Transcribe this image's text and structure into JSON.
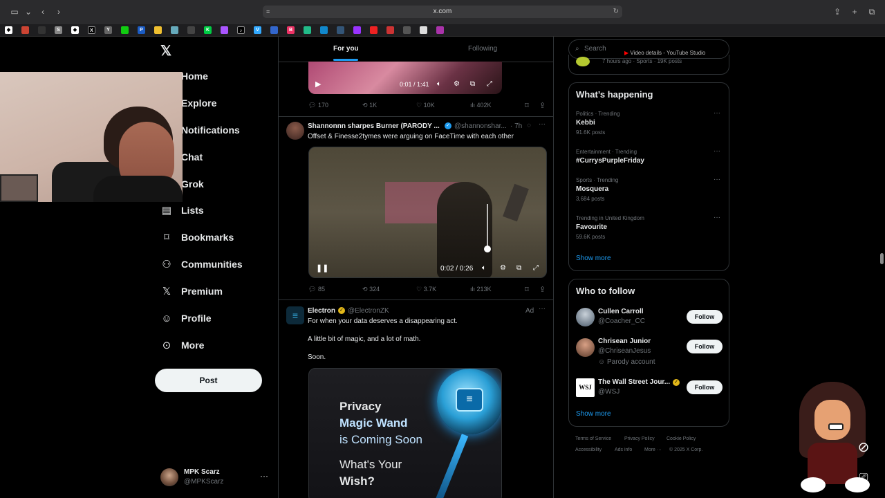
{
  "browser": {
    "url": "x.com",
    "youtube_tab": "Video details - YouTube Studio"
  },
  "nav": {
    "items": [
      {
        "label": "Home",
        "icon": "home-icon"
      },
      {
        "label": "Explore",
        "icon": "search-icon"
      },
      {
        "label": "Notifications",
        "icon": "bell-icon"
      },
      {
        "label": "Chat",
        "icon": "mail-icon"
      },
      {
        "label": "Grok",
        "icon": "grok-icon"
      },
      {
        "label": "Lists",
        "icon": "lists-icon"
      },
      {
        "label": "Bookmarks",
        "icon": "bookmark-icon"
      },
      {
        "label": "Communities",
        "icon": "communities-icon"
      },
      {
        "label": "Premium",
        "icon": "x-logo-icon"
      },
      {
        "label": "Profile",
        "icon": "person-icon"
      },
      {
        "label": "More",
        "icon": "more-circle-icon"
      }
    ],
    "post_label": "Post",
    "account": {
      "name": "MPK Scarz",
      "handle": "@MPKScarz"
    }
  },
  "feed": {
    "tabs": [
      "For you",
      "Following"
    ],
    "post1": {
      "video_time": "0:01 / 1:41",
      "replies": "170",
      "reposts": "1K",
      "likes": "10K",
      "views": "402K"
    },
    "post2": {
      "author": "Shannonnn sharpes Burner (PARODY ...",
      "handle": "@shannonshar...",
      "time": "· 7h",
      "text": "Offset & Finesse2tymes were arguing on FaceTime with  each other",
      "video_time": "0:02 / 0:26",
      "replies": "85",
      "reposts": "324",
      "likes": "3.7K",
      "views": "213K"
    },
    "post3": {
      "author": "Electron",
      "handle": "@ElectronZK",
      "ad_label": "Ad",
      "line1": "For when your data deserves a disappearing act.",
      "line2": "A little bit of magic, and a lot of math.",
      "line3": "Soon.",
      "promo_l1": "Privacy",
      "promo_l2": "Magic Wand",
      "promo_l3": "is Coming Soon",
      "promo_l4": "What's Your",
      "promo_l5": "Wish?"
    }
  },
  "right": {
    "search_placeholder": "Search",
    "top_meta": "7 hours ago · Sports · 19K posts",
    "happening_title": "What’s happening",
    "trends": [
      {
        "meta": "Politics · Trending",
        "name": "Kebbi",
        "count": "91.6K posts"
      },
      {
        "meta": "Entertainment · Trending",
        "name": "#CurrysPurpleFriday",
        "count": ""
      },
      {
        "meta": "Sports · Trending",
        "name": "Mosquera",
        "count": "3,684 posts"
      },
      {
        "meta": "Trending in United Kingdom",
        "name": "Favourite",
        "count": "59.6K posts"
      }
    ],
    "show_more": "Show more",
    "follow_title": "Who to follow",
    "follows": [
      {
        "name": "Cullen Carroll",
        "handle": "@Coacher_CC",
        "note": ""
      },
      {
        "name": "Chrisean Junior",
        "handle": "@ChriseanJesus",
        "note": "Parody account"
      },
      {
        "name": "The Wall Street Jour...",
        "handle": "@WSJ",
        "note": ""
      }
    ],
    "follow_label": "Follow",
    "wsj_logo": "WSJ",
    "footer": [
      "Terms of Service",
      "Privacy Policy",
      "Cookie Policy",
      "Accessibility",
      "Ads info",
      "More ···",
      "© 2025 X Corp."
    ]
  },
  "colors": {
    "accent": "#1d9bf0",
    "background": "#000000",
    "border": "#2f3336",
    "muted": "#71767b"
  }
}
